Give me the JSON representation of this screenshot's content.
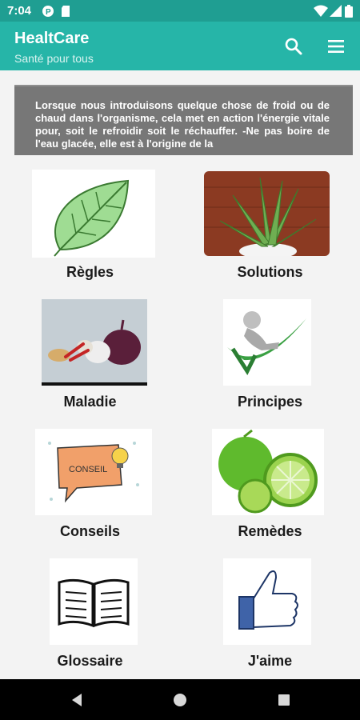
{
  "status": {
    "time": "7:04"
  },
  "app": {
    "title": "HealtCare",
    "subtitle": "Santé pour tous"
  },
  "banner": {
    "text": "Lorsque nous introduisons quelque chose de froid ou de chaud dans l'organisme, cela met en action l'énergie vitale pour, soit le refroidir soit le réchauffer. -Ne pas boire de l'eau glacée, elle est à l'origine de la"
  },
  "menu": [
    {
      "label": "Règles",
      "icon": "leaf-icon"
    },
    {
      "label": "Solutions",
      "icon": "aloe-plant-icon"
    },
    {
      "label": "Maladie",
      "icon": "garlic-onion-icon"
    },
    {
      "label": "Principes",
      "icon": "relaxing-figure-icon"
    },
    {
      "label": "Conseils",
      "icon": "conseil-bubble-icon"
    },
    {
      "label": "Remèdes",
      "icon": "lime-icon"
    },
    {
      "label": "Glossaire",
      "icon": "open-book-icon"
    },
    {
      "label": "J'aime",
      "icon": "thumbs-up-icon"
    }
  ],
  "colors": {
    "status_bar": "#1f9e92",
    "app_bar": "#26b5a8",
    "banner": "#777777",
    "background": "#f3f3f3",
    "nav_bar": "#000000"
  }
}
